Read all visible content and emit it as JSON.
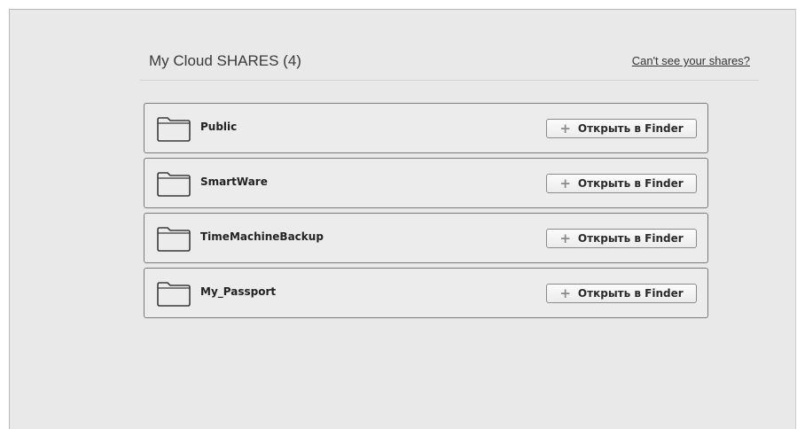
{
  "header": {
    "title": "My Cloud SHARES (4)",
    "help_link": "Can't see your shares?"
  },
  "shares": [
    {
      "name": "Public",
      "icon": "folder-icon",
      "action_label": "Открыть в Finder",
      "action_icon": "plus-icon"
    },
    {
      "name": "SmartWare",
      "icon": "folder-icon",
      "action_label": "Открыть в Finder",
      "action_icon": "plus-icon"
    },
    {
      "name": "TimeMachineBackup",
      "icon": "folder-icon",
      "action_label": "Открыть в Finder",
      "action_icon": "plus-icon"
    },
    {
      "name": "My_Passport",
      "icon": "folder-icon",
      "action_label": "Открыть в Finder",
      "action_icon": "plus-icon"
    }
  ],
  "colors": {
    "background": "#e9e9e9",
    "row_border": "#7a7a7a",
    "text": "#222222"
  }
}
